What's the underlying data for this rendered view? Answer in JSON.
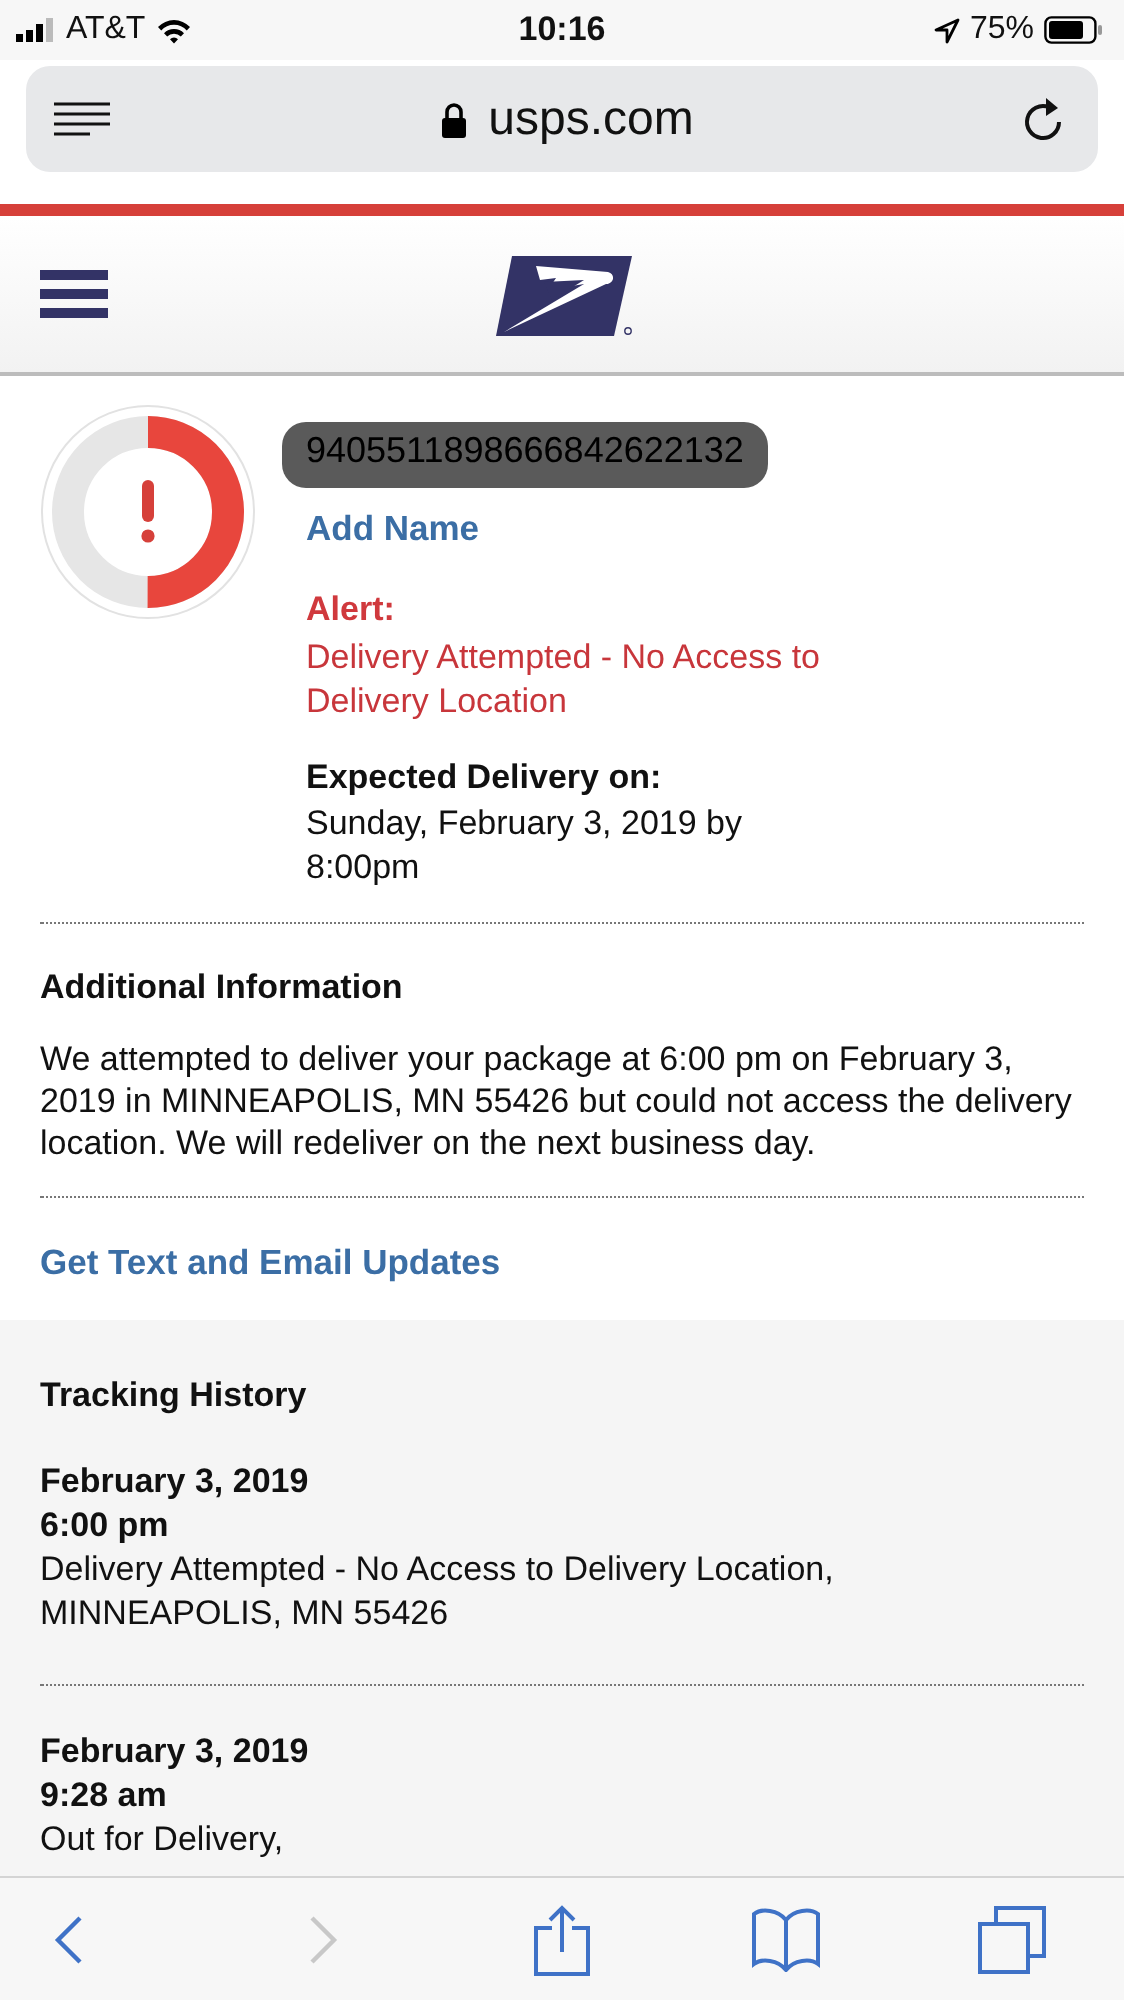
{
  "status_bar": {
    "carrier": "AT&T",
    "time": "10:16",
    "battery": "75%"
  },
  "browser": {
    "url": "usps.com"
  },
  "tracking": {
    "number": "9405511898666842622132",
    "redacted": true,
    "progress": {
      "level": 0.5
    },
    "add_name": "Add Name",
    "alert_label": "Alert:",
    "alert_text": "Delivery Attempted - No Access to Delivery Location",
    "expected_label": "Expected Delivery on:",
    "expected_text": "Sunday, February 3, 2019 by 8:00pm"
  },
  "additional": {
    "title": "Additional Information",
    "text": "We attempted to deliver your package at 6:00 pm on February 3, 2019 in MINNEAPOLIS, MN 55426 but could not access the delivery location. We will redeliver on the next business day.",
    "updates_link": "Get Text and Email Updates"
  },
  "history": {
    "title": "Tracking History",
    "events": [
      {
        "date": "February 3, 2019",
        "time": "6:00 pm",
        "text": "Delivery Attempted - No Access to Delivery Location, MINNEAPOLIS, MN 55426"
      },
      {
        "date": "February 3, 2019",
        "time": "9:28 am",
        "text": "Out for Delivery,"
      }
    ]
  },
  "toolbar": [
    {
      "kind": "back",
      "disabled": false
    },
    {
      "kind": "forward",
      "disabled": true
    },
    {
      "kind": "share",
      "disabled": false
    },
    {
      "kind": "bookmarks",
      "disabled": false
    },
    {
      "kind": "tabs",
      "disabled": false
    }
  ]
}
